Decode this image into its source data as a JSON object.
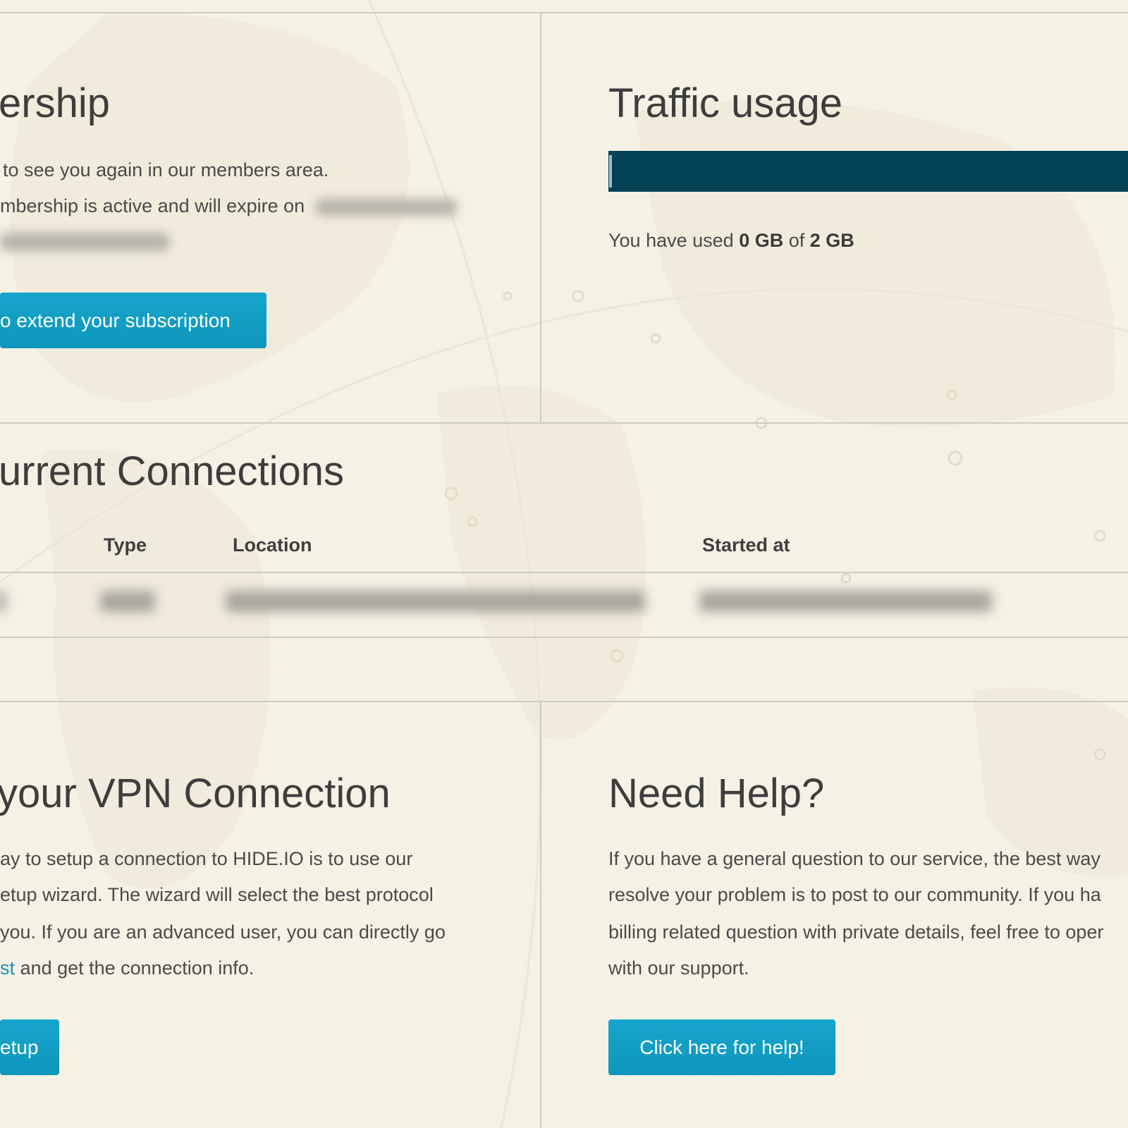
{
  "membership": {
    "title": "ership",
    "welcome": "to see you again in our members area.",
    "status_text": "mbership is active and will expire on",
    "extend_button": "o extend your subscription"
  },
  "traffic": {
    "title": "Traffic usage",
    "used_prefix": "You have used",
    "used_value": "0 GB",
    "of_text": "of",
    "total_value": "2 GB",
    "used_fraction": 0.0,
    "bar_color": "#044255"
  },
  "connections": {
    "title": "urrent Connections",
    "columns": {
      "type": "Type",
      "location": "Location",
      "started": "Started at"
    }
  },
  "setup": {
    "title": "your VPN Connection",
    "lines": [
      "ay to setup a connection to HIDE.IO is to use our",
      "etup wizard. The wizard will select the best protocol",
      "you. If you are an advanced user, you can directly go"
    ],
    "line4_link": "st",
    "line4_rest": "and get the connection info.",
    "button": "etup"
  },
  "help": {
    "title": "Need Help?",
    "lines": [
      "If you have a general question to our service, the best way",
      "resolve your problem is to post to our community. If you ha",
      "billing related question with private details, feel free to oper",
      "with our support."
    ],
    "button": "Click here for help!"
  },
  "colors": {
    "accent": "#15a5cc",
    "background": "#f5f1e4",
    "link": "#1a8fb8"
  }
}
